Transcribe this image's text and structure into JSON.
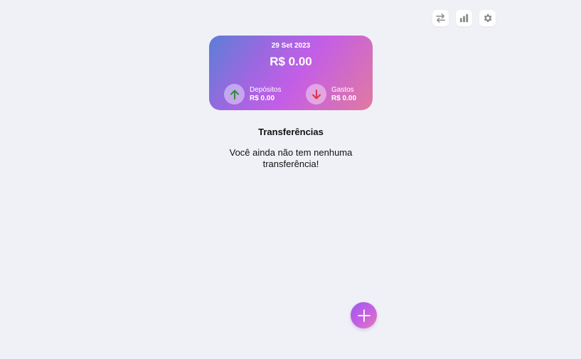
{
  "toolbar": {
    "icons": [
      "transfer-arrows-icon",
      "bar-chart-icon",
      "gear-icon"
    ]
  },
  "card": {
    "date": "29 Set 2023",
    "total": "R$ 0.00",
    "deposits": {
      "label": "Depósitos",
      "value": "R$ 0.00",
      "icon": "arrow-up-icon",
      "color": "#2e8b3a"
    },
    "expenses": {
      "label": "Gastos",
      "value": "R$ 0.00",
      "icon": "arrow-down-icon",
      "color": "#e0324a"
    }
  },
  "transfers": {
    "title": "Transferências",
    "empty_message": "Você ainda não tem nenhuma transferência!"
  },
  "fab": {
    "icon": "plus-icon"
  },
  "colors": {
    "background": "#f0f1f6",
    "card_gradient_start": "#5b7fd6",
    "card_gradient_mid": "#c45ee6",
    "card_gradient_end": "#e07aa0"
  }
}
